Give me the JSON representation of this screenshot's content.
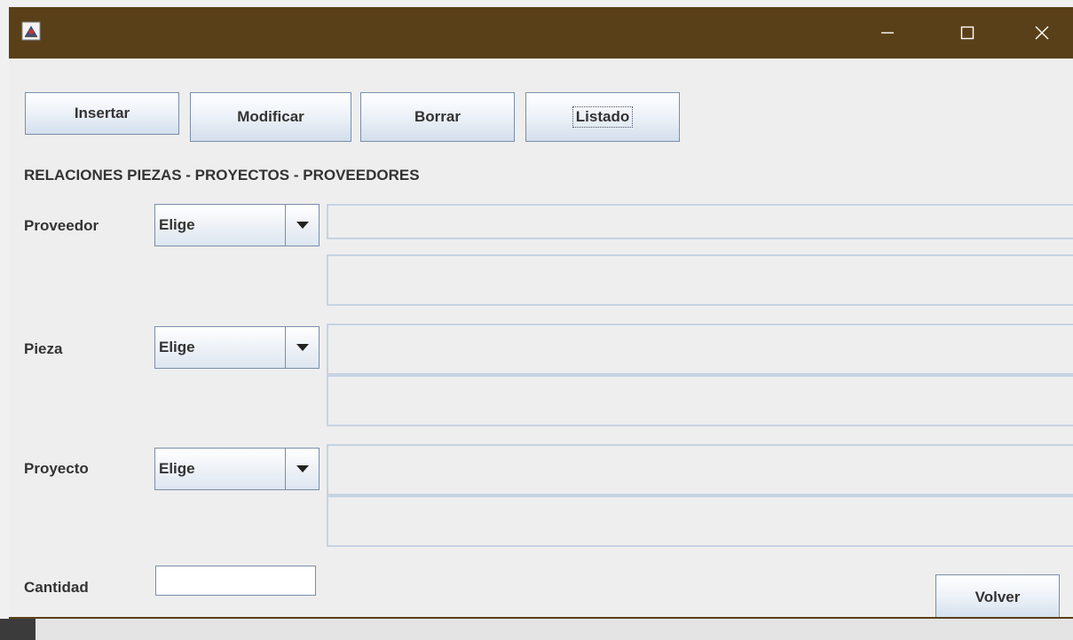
{
  "window": {
    "title": "",
    "icon": "java-app-icon",
    "controls": [
      "minimize-icon",
      "maximize-icon",
      "close-icon"
    ],
    "titlebar_color": "#5a4018"
  },
  "toolbar": {
    "insertar_label": "Insertar",
    "modificar_label": "Modificar",
    "borrar_label": "Borrar",
    "listado_label": "Listado"
  },
  "form": {
    "heading": "RELACIONES PIEZAS - PROYECTOS - PROVEEDORES",
    "proveedor": {
      "label": "Proveedor",
      "selected": "Elige"
    },
    "pieza": {
      "label": "Pieza",
      "selected": "Elige"
    },
    "proyecto": {
      "label": "Proyecto",
      "selected": "Elige"
    },
    "cantidad": {
      "label": "Cantidad",
      "value": ""
    }
  },
  "footer": {
    "volver_label": "Volver"
  }
}
